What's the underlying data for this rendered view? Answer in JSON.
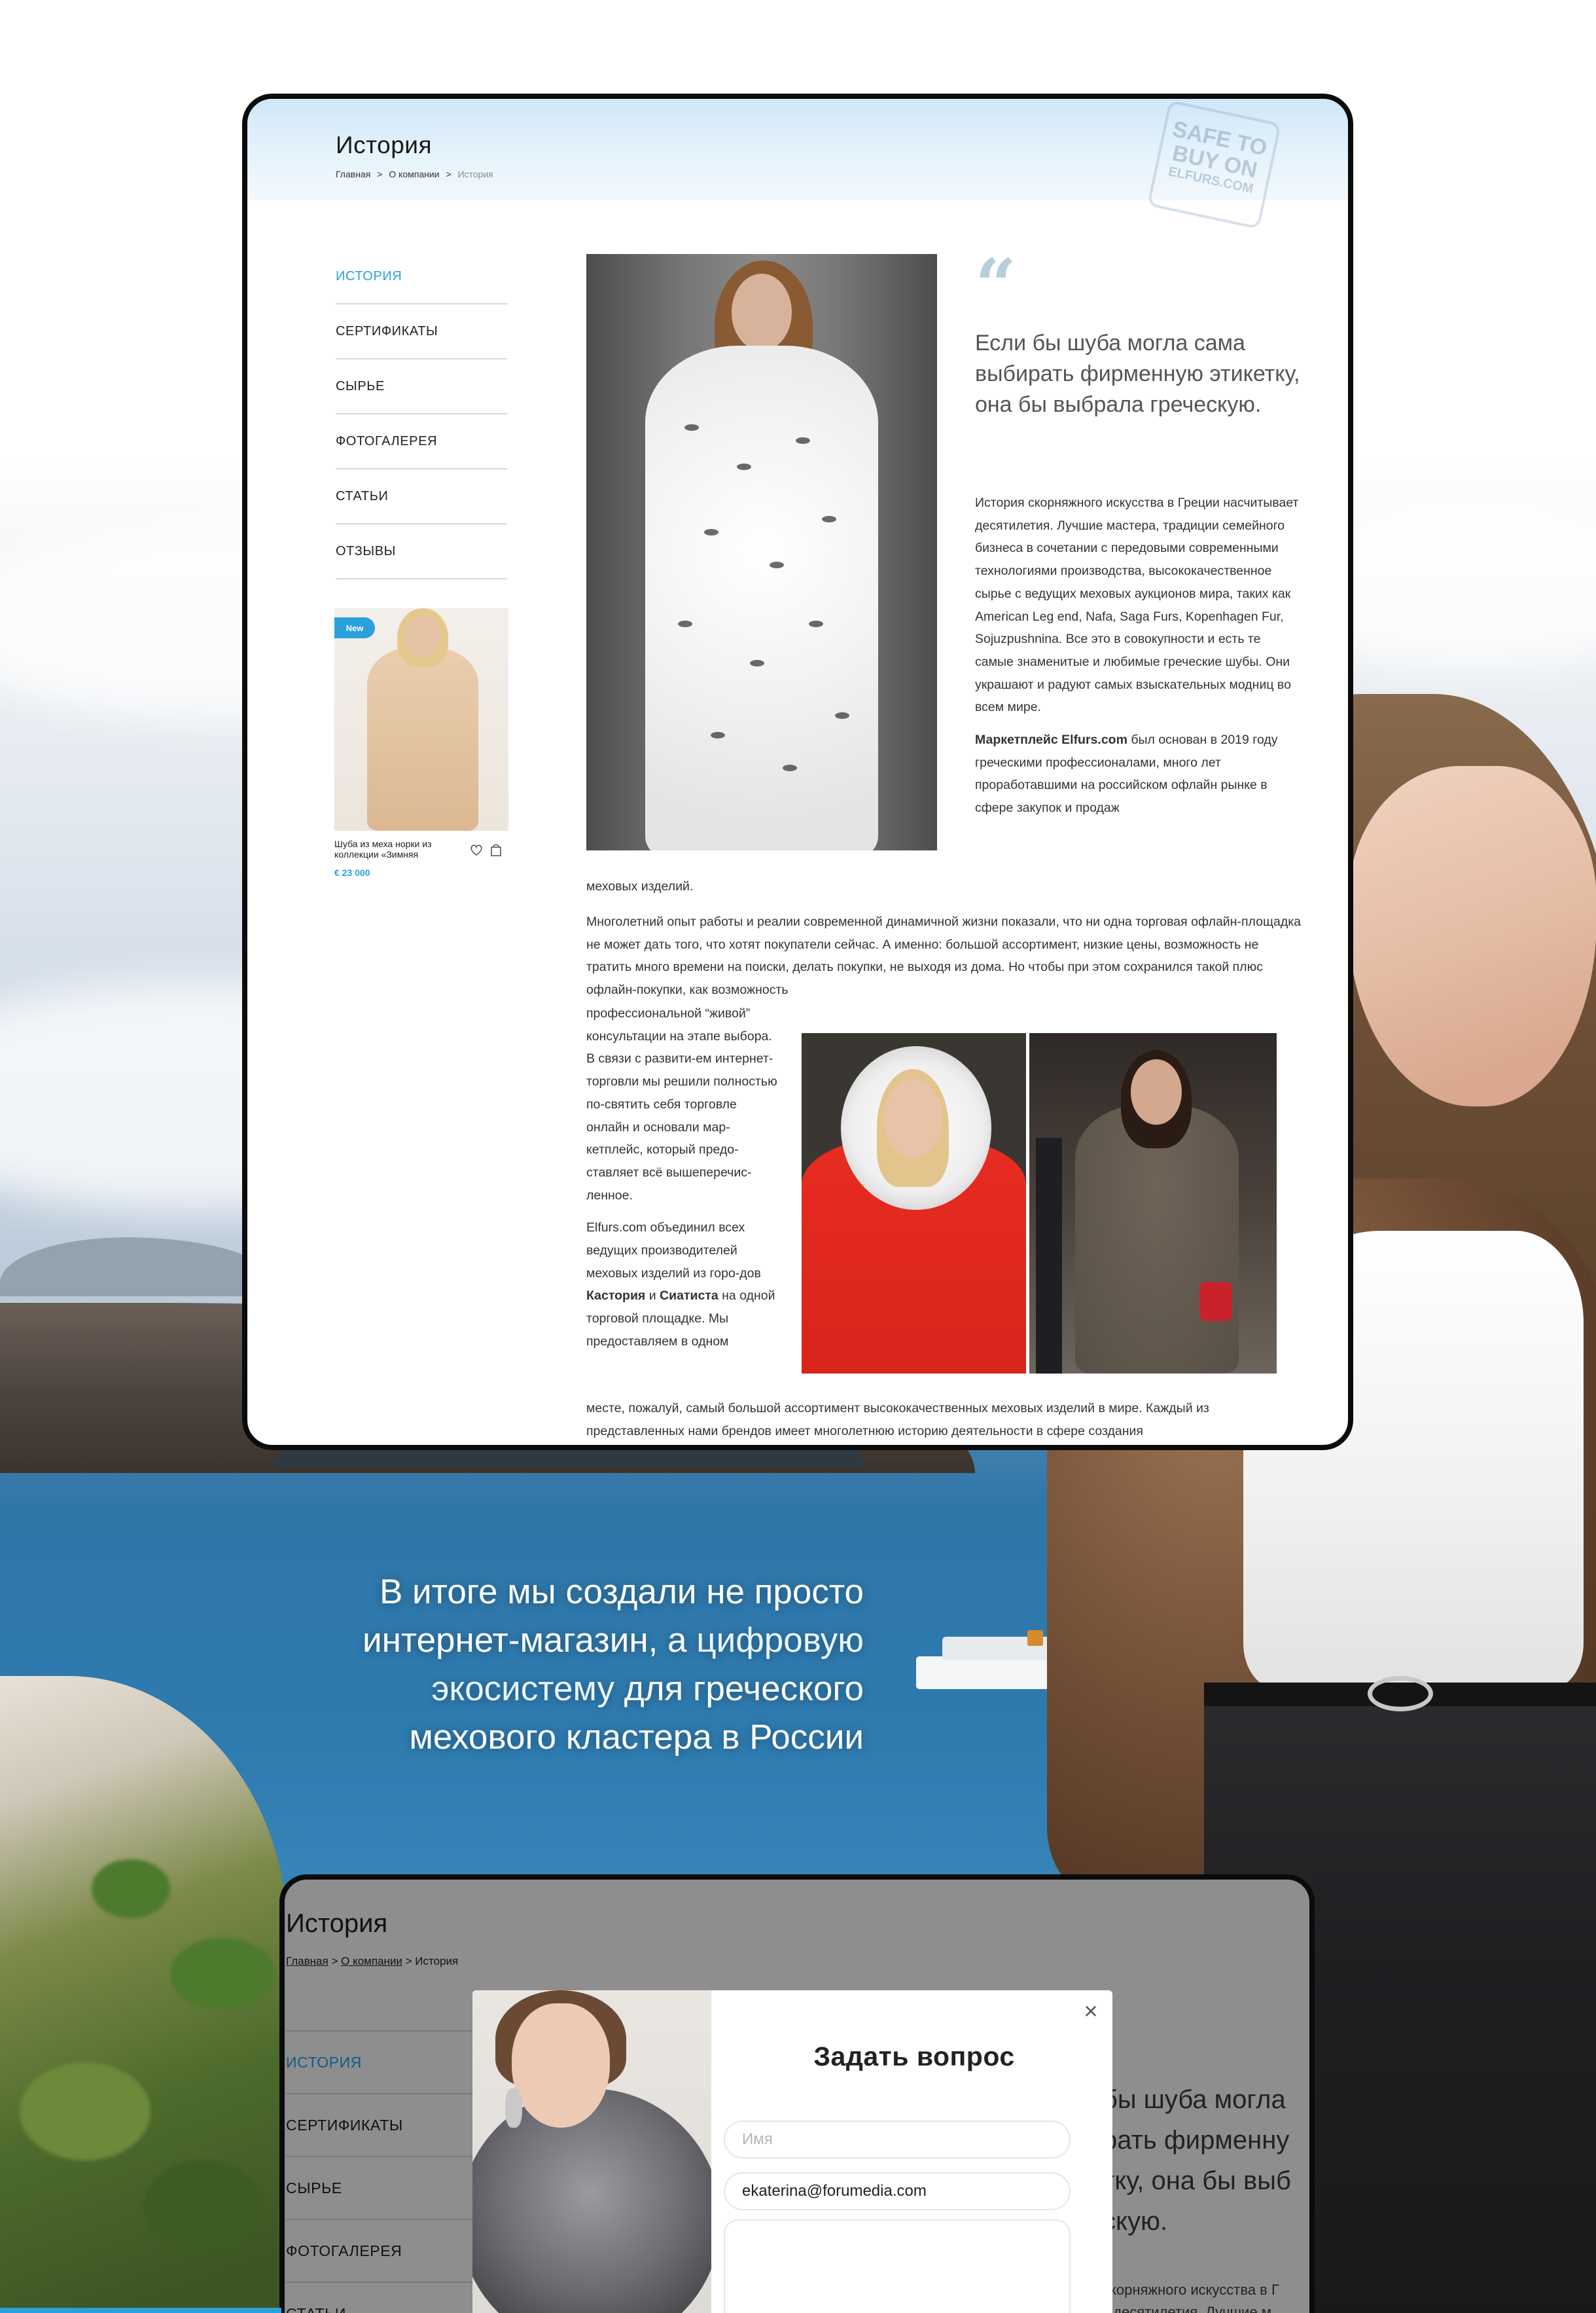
{
  "colors": {
    "accent": "#2aa1dc",
    "text": "#333333",
    "frame": "#0b0b0b"
  },
  "mockup_top": {
    "title": "История",
    "breadcrumb": {
      "home": "Главная",
      "sep": ">",
      "company": "О компании",
      "current": "История"
    },
    "stamp": {
      "line1": "SAFE TO",
      "line2": "BUY ON",
      "line3": "ELFURS.COM"
    },
    "sidebar": {
      "items": [
        {
          "label": "ИСТОРИЯ",
          "active": true
        },
        {
          "label": "СЕРТИФИКАТЫ"
        },
        {
          "label": "СЫРЬЕ"
        },
        {
          "label": "ФОТОГАЛЕРЕЯ"
        },
        {
          "label": "СТАТЬИ"
        },
        {
          "label": "ОТЗЫВЫ"
        }
      ]
    },
    "promo": {
      "badge": "New",
      "name": "Шуба из меха норки из коллекции «Зимняя",
      "price": "€ 23 000",
      "icons": [
        "heart-icon",
        "bag-icon"
      ]
    },
    "quote": "Если бы шуба могла сама выбирать фирменную этикетку, она бы выбрала греческую.",
    "para1": "История скорняжного искусства в Греции насчитывает десятилетия. Лучшие мастера, традиции семейного бизнеса в сочетании с передовыми современными технологиями производства, высококачественное сырье с ведущих меховых аукционов мира, таких как American Leg end, Nafa, Saga Furs, Kopenhagen Fur, Sojuzpushnina. Все это в совокупности и есть те самые знаменитые и любимые греческие шубы. Они украшают и радуют самых взыскательных модниц во всем мире.",
    "para2_bold": "Маркетплейс Elfurs.com",
    "para2_rest": " был основан в 2019 году греческими профессионалами, много лет проработавшими на российском офлайн рынке в сфере закупок и продаж",
    "para2_tail": "меховых изделий.",
    "para3": "Многолетний опыт работы и реалии современной динамичной жизни показали, что ни одна торговая офлайн-площадка не может дать того, что хотят покупатели сейчас. А именно: большой ассортимент, низкие цены, возможность не тратить много времени на поиски, делать покупки, не выходя из дома. Но чтобы при этом сохранился такой плюс офлайн-покупки, как возможность",
    "para4": "профессиональной “живой” консультации на этапе выбора. В связи с развити-ем интернет-торговли мы решили полностью по-святить себя торговле онлайн и основали мар-кетплейс, который предо-ставляет всё вышеперечис-ленное.",
    "para5_a": "Elfurs.com объединил всех ведущих производителей меховых изделий из горо-дов ",
    "para5_b1": "Кастория",
    "para5_and": " и ",
    "para5_b2": "Сиатиста",
    "para5_c": " на одной торговой площадке. Мы предоставляем в одном",
    "para6": "месте, пожалуй, самый большой ассортимент высококачественных меховых изделий в мире. Каждый из представленных нами брендов имеет многолетнюю историю деятельности в сфере создания"
  },
  "slogan": {
    "part1": "В итоге мы создали не просто интернет-магазин, а ",
    "accent": "цифровую экосистему",
    "part2": " для греческого мехового кластера в России"
  },
  "mockup_bottom": {
    "title": "История",
    "breadcrumb": {
      "home": "Главная",
      "sep": ">",
      "company": "О компании",
      "current": "История"
    },
    "sidebar": {
      "items": [
        {
          "label": "ИСТОРИЯ",
          "active": true
        },
        {
          "label": "СЕРТИФИКАТЫ"
        },
        {
          "label": "СЫРЬЕ"
        },
        {
          "label": "ФОТОГАЛЕРЕЯ"
        },
        {
          "label": "СТАТЬИ"
        }
      ]
    },
    "quote_lines": [
      "бы шуба могла",
      "рать фирменну",
      "тку, она бы выб",
      "скую."
    ],
    "text_lines": [
      "скорняжного искусства в Г",
      "т десятилетия. Лучшие м"
    ],
    "modal": {
      "title": "Задать вопрос",
      "name_placeholder": "Имя",
      "email_value": "ekaterina@forumedia.com",
      "close": "×"
    }
  }
}
